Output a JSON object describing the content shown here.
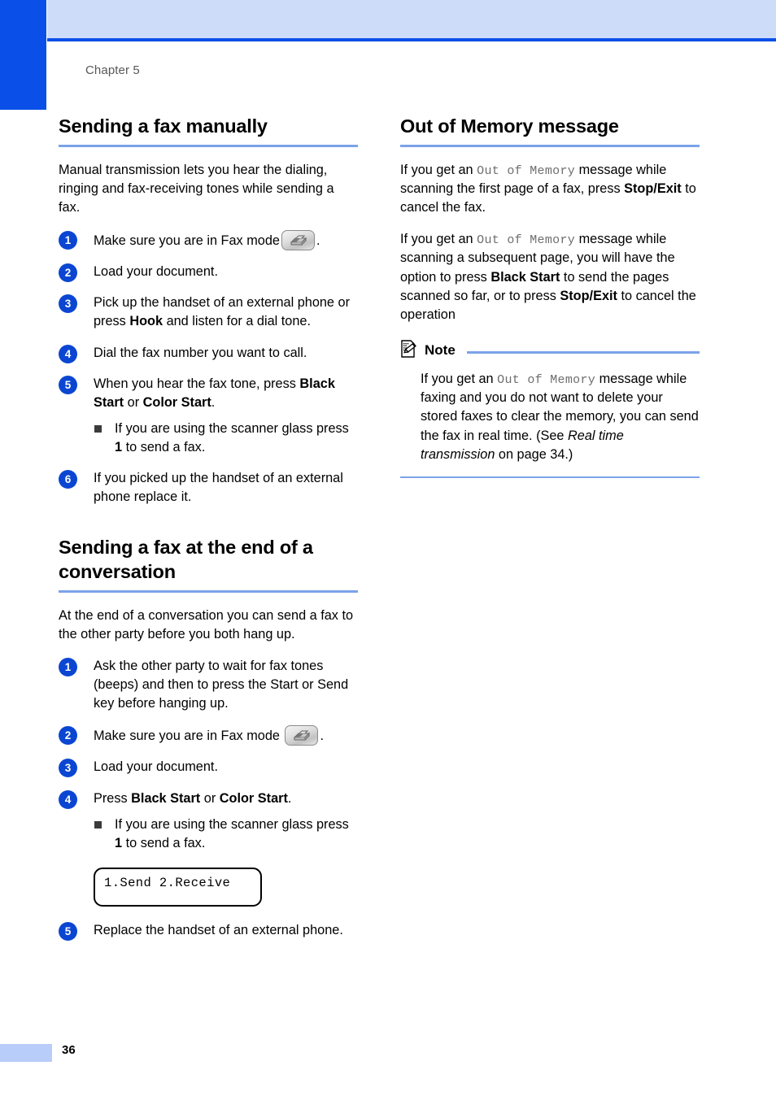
{
  "page": {
    "chapter_label": "Chapter 5",
    "page_number": "36",
    "accent_blue": "#0a50e8",
    "band_blue": "#cddcf8",
    "rule_blue": "#7ba3ea",
    "step_circle_blue": "#0b46d2"
  },
  "left_column": {
    "section1": {
      "title": "Sending a fax manually",
      "intro": "Manual transmission lets you hear the dialing, ringing and fax-receiving tones while sending a fax.",
      "steps": [
        {
          "num": "1",
          "text_before": "Make sure you are in Fax mode",
          "icon": "fax-mode-key-icon",
          "text_after": "."
        },
        {
          "num": "2",
          "text": "Load your document."
        },
        {
          "num": "3",
          "parts": [
            {
              "t": "Pick up the handset of an external phone or press ",
              "bold": false
            },
            {
              "t": "Hook",
              "bold": true
            },
            {
              "t": " and listen for a dial tone.",
              "bold": false
            }
          ]
        },
        {
          "num": "4",
          "text": "Dial the fax number you want to call."
        },
        {
          "num": "5",
          "parts": [
            {
              "t": "When you hear the fax tone, press ",
              "bold": false
            },
            {
              "t": "Black Start",
              "bold": true
            },
            {
              "t": " or ",
              "bold": false
            },
            {
              "t": "Color Start",
              "bold": true
            },
            {
              "t": ".",
              "bold": false
            }
          ],
          "substeps": [
            {
              "parts": [
                {
                  "t": "If you are using the scanner glass press ",
                  "bold": false
                },
                {
                  "t": "1",
                  "bold": true
                },
                {
                  "t": " to send a fax.",
                  "bold": false
                }
              ]
            }
          ]
        },
        {
          "num": "6",
          "text": "If you picked up the handset of an external phone replace it."
        }
      ]
    },
    "section2": {
      "title": "Sending a fax at the end of a conversation",
      "intro": "At the end of a conversation you can send a fax to the other party before you both hang up.",
      "steps": [
        {
          "num": "1",
          "text": "Ask the other party to wait for fax tones (beeps) and then to press the Start or Send key before hanging up."
        },
        {
          "num": "2",
          "text_before": "Make sure you are in Fax mode",
          "icon": "fax-mode-key-icon",
          "text_after": "."
        },
        {
          "num": "3",
          "text": "Load your document."
        },
        {
          "num": "4",
          "parts": [
            {
              "t": "Press ",
              "bold": false
            },
            {
              "t": "Black Start",
              "bold": true
            },
            {
              "t": " or ",
              "bold": false
            },
            {
              "t": "Color Start",
              "bold": true
            },
            {
              "t": ".",
              "bold": false
            }
          ],
          "substeps": [
            {
              "parts": [
                {
                  "t": "If you are using the scanner glass press ",
                  "bold": false
                },
                {
                  "t": "1",
                  "bold": true
                },
                {
                  "t": " to send a fax.",
                  "bold": false
                }
              ]
            }
          ],
          "lcd": "1.Send 2.Receive"
        },
        {
          "num": "5",
          "text": "Replace the handset of an external phone."
        }
      ]
    }
  },
  "right_column": {
    "section": {
      "title": "Out of Memory message",
      "paragraph1": [
        {
          "t": "If you get an ",
          "style": "normal"
        },
        {
          "t": "Out of Memory",
          "style": "lcd"
        },
        {
          "t": " message while scanning the first page of a fax, press ",
          "style": "normal"
        },
        {
          "t": "Stop/Exit",
          "style": "bold"
        },
        {
          "t": " to cancel the fax.",
          "style": "normal"
        }
      ],
      "paragraph2": [
        {
          "t": "If you get an ",
          "style": "normal"
        },
        {
          "t": "Out of Memory",
          "style": "lcd"
        },
        {
          "t": " message while scanning a subsequent page, you will have the option to press ",
          "style": "normal"
        },
        {
          "t": "Black Start",
          "style": "bold"
        },
        {
          "t": " to send the pages scanned so far, or to press ",
          "style": "normal"
        },
        {
          "t": "Stop/Exit",
          "style": "bold"
        },
        {
          "t": " to cancel the operation",
          "style": "normal"
        }
      ]
    },
    "note": {
      "icon": "note-pencil-paper-icon",
      "title": "Note",
      "body": [
        {
          "t": "If you get an ",
          "style": "normal"
        },
        {
          "t": "Out of Memory",
          "style": "lcd"
        },
        {
          "t": " message while faxing and you do not want to delete your stored faxes to clear the memory, you can send the fax in real time. (See ",
          "style": "normal"
        },
        {
          "t": "Real time transmission",
          "style": "italic"
        },
        {
          "t": " on page 34.)",
          "style": "normal"
        }
      ]
    }
  }
}
